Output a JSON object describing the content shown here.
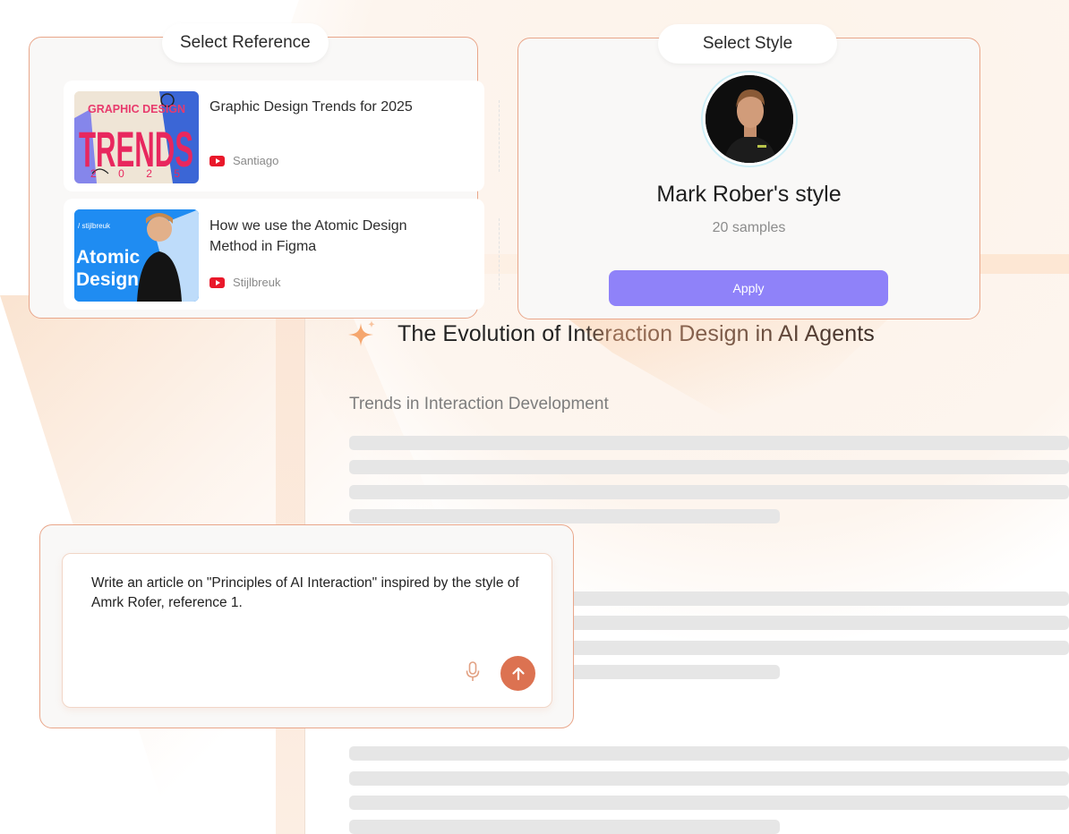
{
  "reference_panel": {
    "label": "Select Reference",
    "items": [
      {
        "title": "Graphic Design Trends for 2025",
        "channel": "Santiago",
        "thumbnail_text": "GRAPHIC DESIGN",
        "thumbnail_big_text": "TRENDS",
        "thumbnail_year": "2 0 2 5",
        "source_icon": "youtube-icon"
      },
      {
        "title": "How we use the Atomic Design Method in Figma",
        "channel": "Stijlbreuk",
        "thumbnail_brand": "/ stijlbreuk",
        "thumbnail_text_1": "Atomic",
        "thumbnail_text_2": "Design",
        "source_icon": "youtube-icon"
      }
    ]
  },
  "style_panel": {
    "label": "Select Style",
    "name": "Mark Rober's style",
    "samples": "20 samples",
    "apply_label": "Apply",
    "apply_color": "#8f82f9"
  },
  "document": {
    "title": "The Evolution of Interaction Design in AI Agents",
    "section_heading": "Trends in Interaction Development",
    "title_icon": "sparkle-icon"
  },
  "prompt": {
    "text": "Write an article on \"Principles of AI Interaction\" inspired by the style of Amrk Rofer, reference 1.",
    "send_color": "#dc7251"
  },
  "colors": {
    "accent_border": "#e9a68a",
    "skeleton": "#e6e6e6"
  }
}
